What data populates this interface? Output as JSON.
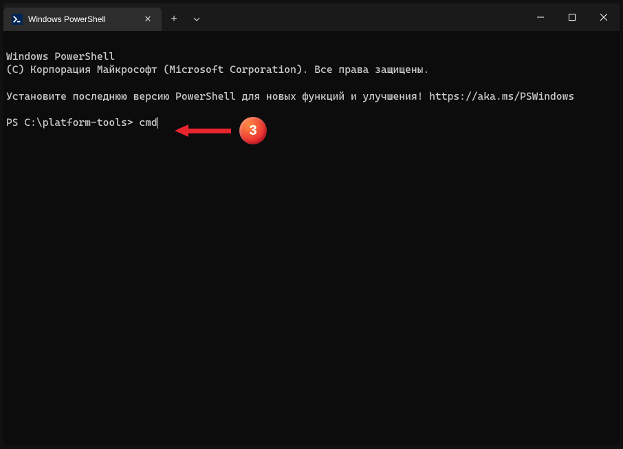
{
  "titlebar": {
    "tab_title": "Windows PowerShell",
    "tab_icon_glyph": ">_"
  },
  "terminal": {
    "line1": "Windows PowerShell",
    "line2": "(C) Корпорация Майкрософт (Microsoft Corporation). Все права защищены.",
    "line3": "Установите последнюю версию PowerShell для новых функций и улучшения! https://aka.ms/PSWindows",
    "prompt": "PS C:\\platform-tools> ",
    "command": "cmd"
  },
  "annotation": {
    "badge_number": "3"
  }
}
